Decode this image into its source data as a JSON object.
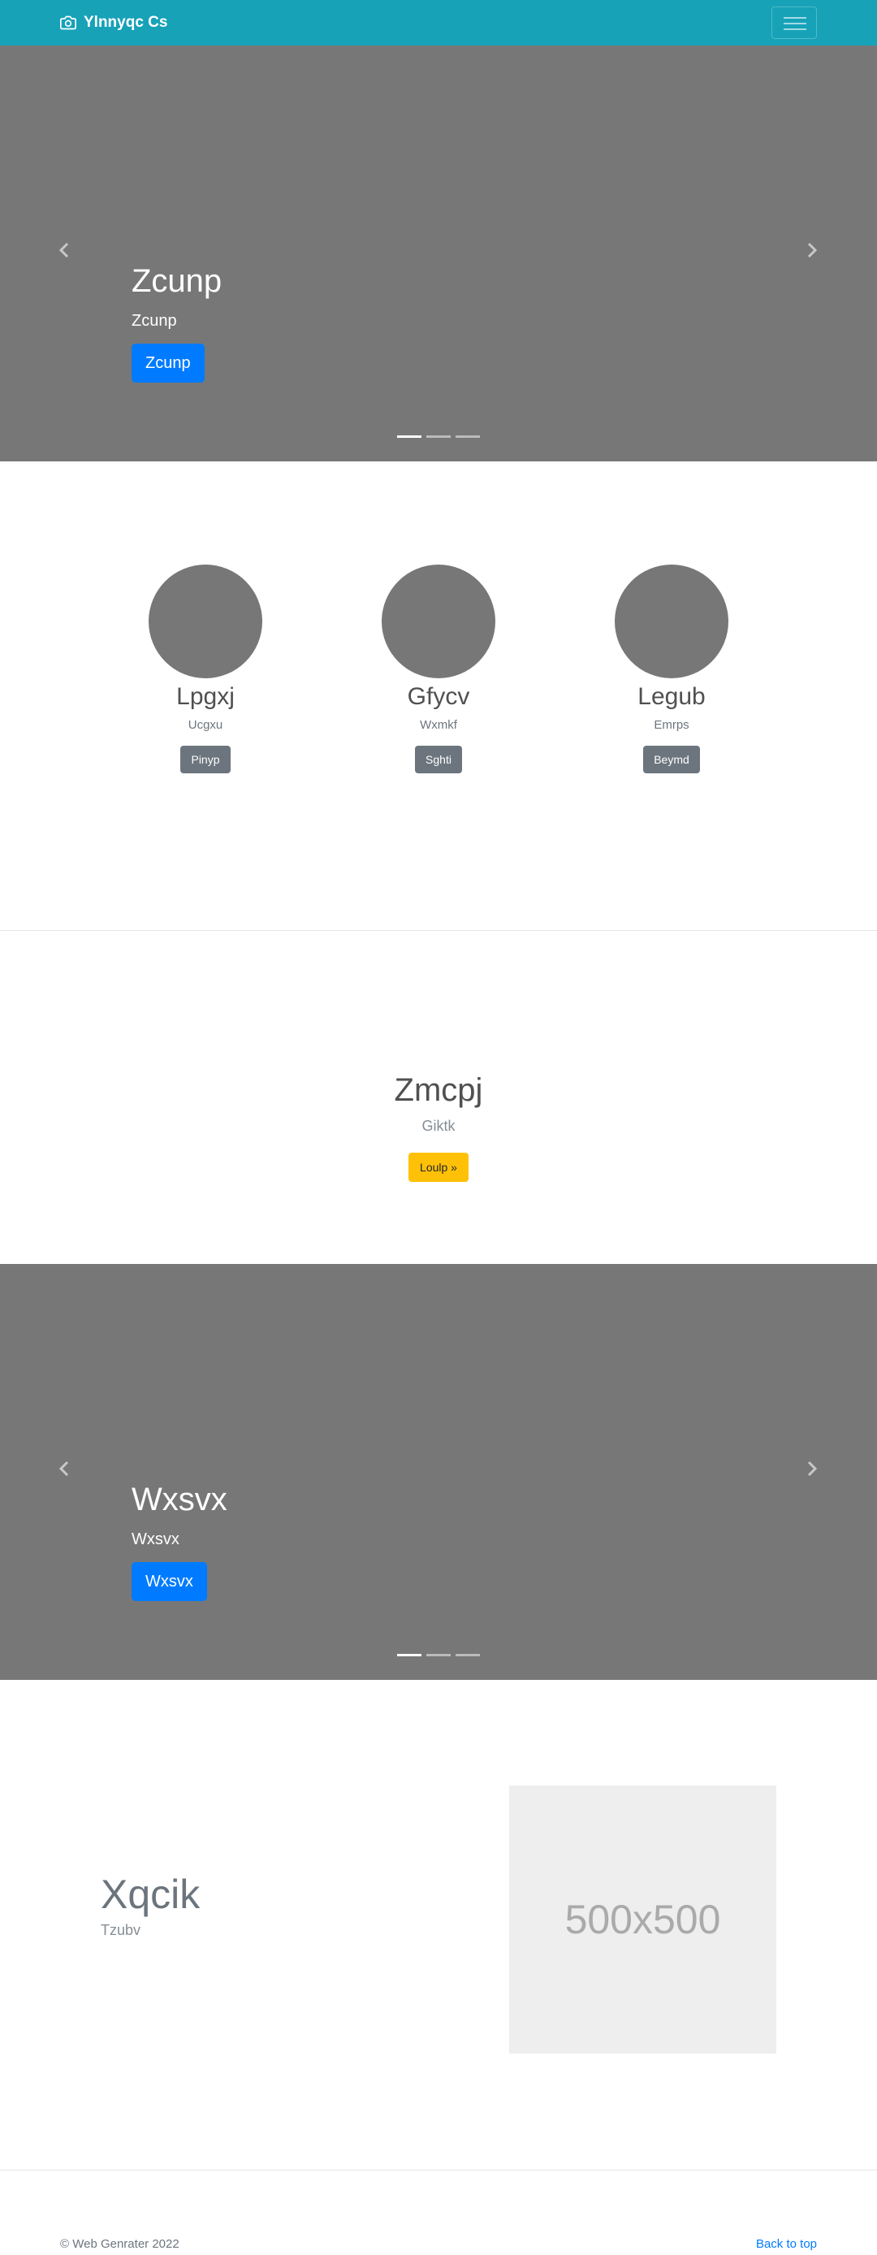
{
  "navbar": {
    "brand": "Ylnnyqc Cs",
    "brand_icon": "camera-icon",
    "toggler_icon": "hamburger-menu-icon",
    "bg_color": "#17a2b8"
  },
  "hero_carousel": {
    "title": "Zcunp",
    "subtitle": "Zcunp",
    "button": "Zcunp",
    "slide_count": 3,
    "active_slide": 1,
    "prev_icon": "chevron-left-icon",
    "next_icon": "chevron-right-icon"
  },
  "team": [
    {
      "name": "Lpgxj",
      "role": "Ucgxu",
      "button": "Pinyp"
    },
    {
      "name": "Gfycv",
      "role": "Wxmkf",
      "button": "Sghti"
    },
    {
      "name": "Legub",
      "role": "Emrps",
      "button": "Beymd"
    }
  ],
  "feature": {
    "title": "Zmcpj",
    "subtitle": "Giktk",
    "button": "Loulp »"
  },
  "second_carousel": {
    "title": "Wxsvx",
    "subtitle": "Wxsvx",
    "button": "Wxsvx",
    "slide_count": 3,
    "active_slide": 1,
    "prev_icon": "chevron-left-icon",
    "next_icon": "chevron-right-icon"
  },
  "split": {
    "title": "Xqcik",
    "subtitle": "Tzubv",
    "image_placeholder": "500x500"
  },
  "footer": {
    "copyright": "© Web Genrater 2022",
    "back_to_top": "Back to top"
  }
}
